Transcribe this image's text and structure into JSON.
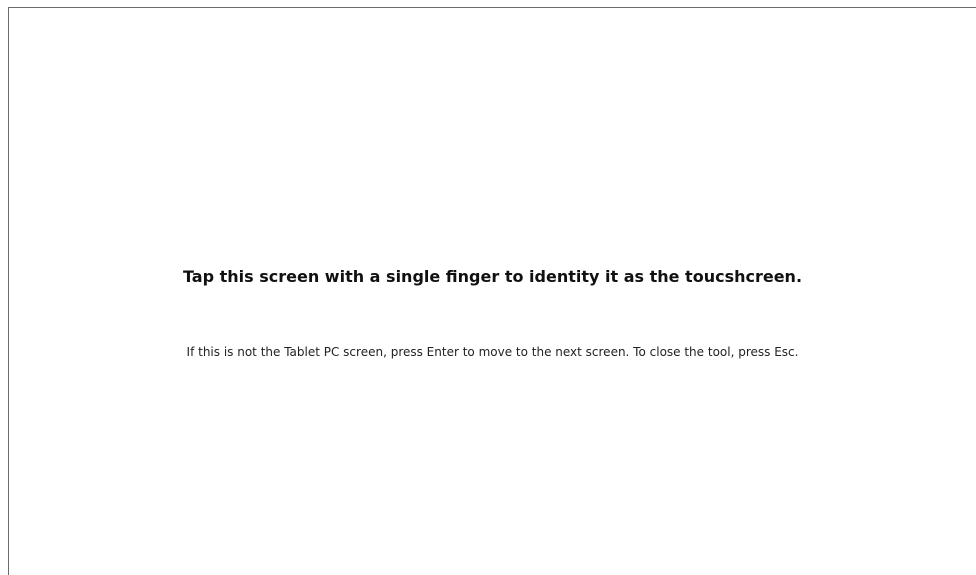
{
  "touch_identify": {
    "headline": "Tap this screen with a single finger to identity it as the toucshcreen.",
    "instructions": "If this is not the Tablet PC screen, press Enter to move to the next screen. To close the tool, press Esc."
  }
}
